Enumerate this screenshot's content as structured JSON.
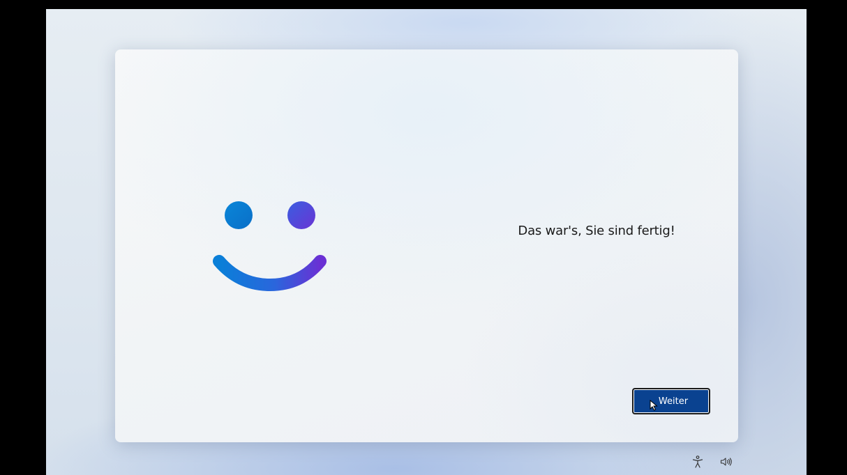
{
  "oobe": {
    "message": "Das war's, Sie sind fertig!",
    "next_button_label": "Weiter",
    "accent_color": "#0a4290",
    "smiley_gradient": [
      "#0a7bd6",
      "#6a3bd6"
    ]
  },
  "tray": {
    "accessibility_icon": "accessibility-icon",
    "volume_icon": "volume-icon"
  }
}
